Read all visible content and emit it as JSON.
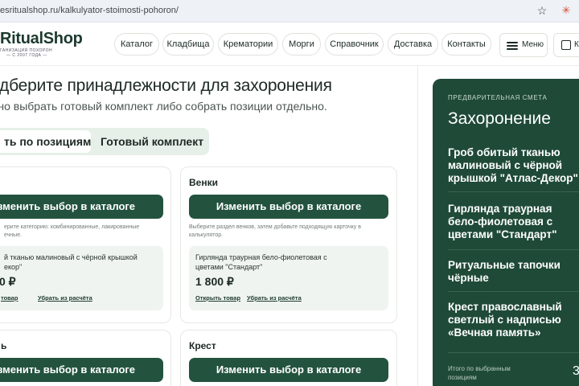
{
  "browser": {
    "url": "esritualshop.ru/kalkulyator-stoimosti-pohoron/",
    "star_icon": "star-icon",
    "extension_icon": "extension-icon"
  },
  "header": {
    "logo_name": "RitualShop",
    "logo_tagline": "ГАНИЗАЦИЯ ПОХОРОН",
    "logo_since": "— С 2007 ГОДА —",
    "nav": [
      "Каталог",
      "Кладбища",
      "Крематории",
      "Морги",
      "Справочник",
      "Доставка",
      "Контакты"
    ],
    "menu_label": "Меню",
    "map_label": "К"
  },
  "main": {
    "title": "одберите принадлежности для захоронения",
    "subtitle": "жно выбрать готовый комплект либо собрать позиции отдельно.",
    "tabs": [
      "ть по позициям",
      "Готовый комплект"
    ]
  },
  "cards": [
    {
      "title": "",
      "button": "зменить выбор в каталоге",
      "hint": "ерите категорию: комбинированные, лакированные ечные.",
      "item_name": "й тканью малиновый с чёрной крышкой екор\"",
      "item_price": "0 ₽",
      "link_open": "товар",
      "link_remove": "Убрать из расчёта"
    },
    {
      "title": "Венки",
      "button": "Изменить выбор в каталоге",
      "hint": "Выберите раздел венков, затем добавьте подходящую карточку в калькулятор.",
      "item_name": "Гирлянда траурная бело-фиолетовая с цветами \"Стандарт\"",
      "item_price": "1 800 ₽",
      "link_open": "Открыть товар",
      "link_remove": "Убрать из расчёта"
    },
    {
      "title": "ь",
      "button": "зменить выбор в каталоге"
    },
    {
      "title": "Крест",
      "button": "Изменить выбор в каталоге"
    }
  ],
  "estimate": {
    "kicker": "ПРЕДВАРИТЕЛЬНАЯ СМЕТА",
    "title": "Захоронение",
    "items": [
      "Гроб обитый тканью малиновый с чёрной крышкой \"Атлас-Декор\"",
      "Гирлянда траурная бело-фиолетовая с цветами \"Стандарт\"",
      "Ритуальные тапочки чёрные",
      "Крест православный светлый с надписью «Вечная память»"
    ],
    "total_label": "Итого по выбранным позициям",
    "total_value": "3"
  },
  "colors": {
    "accent": "#23533f",
    "panel": "#1f4a38",
    "tab_bg": "#e7efe9",
    "item_bg": "#eff4f0"
  }
}
